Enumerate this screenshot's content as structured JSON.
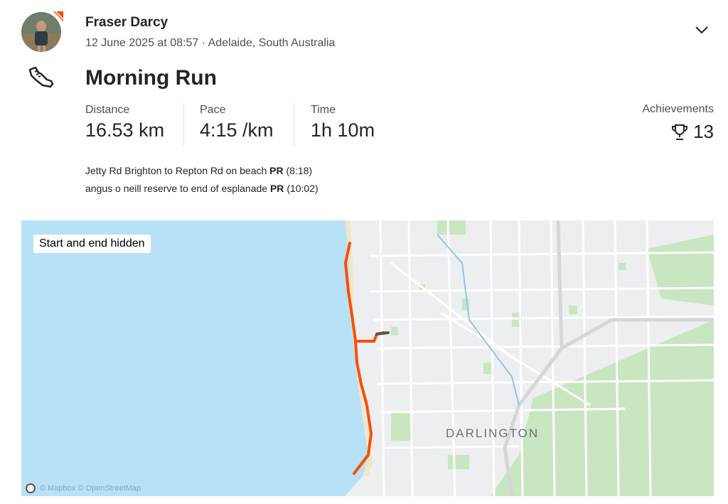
{
  "athlete": {
    "name": "Fraser Darcy",
    "date": "12 June 2025 at 08:57",
    "separator": " · ",
    "location": "Adelaide, South Australia"
  },
  "activity": {
    "title": "Morning Run",
    "icon": "running-shoe-icon"
  },
  "stats": [
    {
      "label": "Distance",
      "value": "16.53 km"
    },
    {
      "label": "Pace",
      "value": "4:15 /km"
    },
    {
      "label": "Time",
      "value": "1h 10m"
    }
  ],
  "achievements": {
    "label": "Achievements",
    "count": "13",
    "icon": "trophy-icon"
  },
  "segments": [
    {
      "name": "Jetty Rd Brighton to Repton Rd on beach",
      "badge": "PR",
      "time": "(8:18)"
    },
    {
      "name": "angus o neill reserve to end of esplanade",
      "badge": "PR",
      "time": "(10:02)"
    }
  ],
  "map": {
    "privacy_label": "Start and end hidden",
    "suburb_label": "DARLINGTON",
    "attribution": "© Mapbox © OpenStreetMap",
    "route_color": "#fc4c02",
    "water_color": "#b7e1f7",
    "park_color": "#c8e6c0"
  },
  "colors": {
    "brand": "#fc4c02",
    "text": "#242428",
    "muted": "#4f4f57"
  }
}
